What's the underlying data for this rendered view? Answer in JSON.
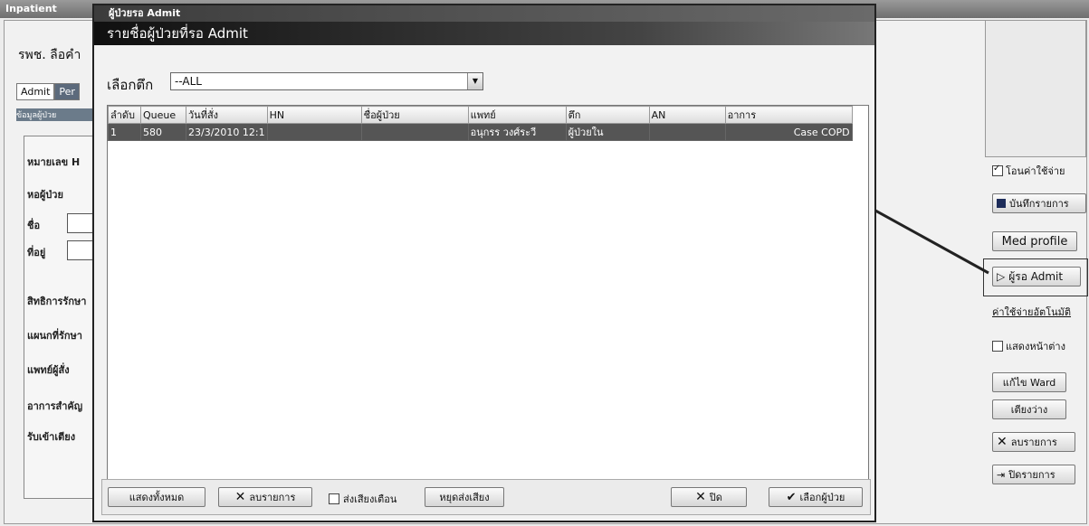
{
  "background_app": {
    "title": "Inpatient",
    "hospital_name": "รพช. ลือคำ",
    "tabs": [
      "Admit",
      "Per"
    ],
    "strip_text": "ข้อมูลผู้ป่วย",
    "left_labels": [
      "หมายเลข H",
      "หอผู้ป่วย",
      "ชื่อ",
      "ที่อยู่",
      "สิทธิการรักษา",
      "แผนกที่รักษา",
      "แพทย์ผู้สั่ง",
      "อาการสำคัญ",
      "รับเข้าเตียง"
    ]
  },
  "sidebar": {
    "checkbox_transfer": "โอนค่าใช้จ่าย",
    "save_button": "บันทึกรายการ",
    "med_profile_button": "Med profile",
    "waiting_admit_button": "ผู้รอ Admit",
    "expense_link": "ค่าใช้จ่ายอัตโนมัติ",
    "checkbox_show_window": "แสดงหน้าต่าง",
    "edit_ward_button": "แก้ไข Ward",
    "empty_bed_button": "เตียงว่าง",
    "delete_button": "ลบรายการ",
    "close_case_button": "ปิดรายการ"
  },
  "modal": {
    "window_title": "ผู้ป่วยรอ Admit",
    "heading": "รายชื่อผู้ป่วยที่รอ Admit",
    "ward_label": "เลือกตึก",
    "ward_value": "--ALL",
    "columns": [
      "ลำดับ",
      "Queue",
      "วันที่สั่ง",
      "HN",
      "ชื่อผู้ป่วย",
      "แพทย์",
      "ตึก",
      "AN",
      "อาการ"
    ],
    "rows": [
      [
        "1",
        "580",
        "23/3/2010 12:1",
        "",
        "",
        "อนุกรร วงศ์ระวี",
        "ผู้ป่วยใน",
        "",
        "Case COPD"
      ]
    ],
    "buttons": {
      "show_all": "แสดงทั้งหมด",
      "delete": "ลบรายการ",
      "sound_alert": "ส่งเสียงเตือน",
      "stop_sound": "หยุดส่งเสียง",
      "close": "ปิด",
      "select_patient": "เลือกผู้ป่วย"
    }
  },
  "colors": {
    "modal_title": "#101010",
    "selected_row": "#555555"
  }
}
